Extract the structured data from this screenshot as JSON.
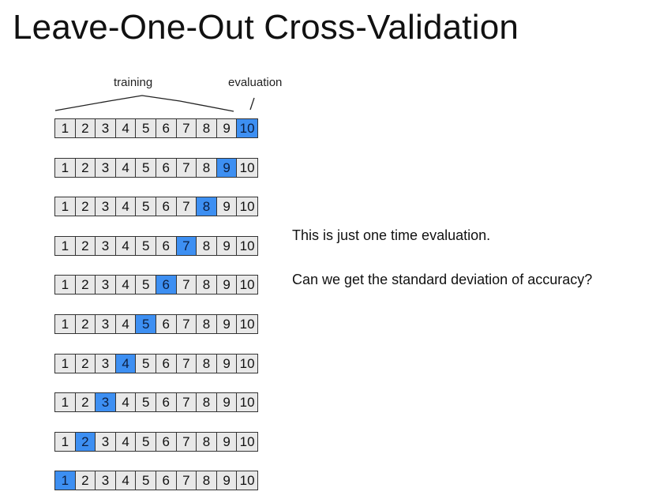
{
  "slide": {
    "title": "Leave-One-Out Cross-Validation"
  },
  "diagram": {
    "training_label": "training",
    "evaluation_label": "evaluation",
    "fold_labels": [
      "1",
      "2",
      "3",
      "4",
      "5",
      "6",
      "7",
      "8",
      "9",
      "10"
    ],
    "evaluation_fold_per_row": [
      10,
      9,
      8,
      7,
      6,
      5,
      4,
      3,
      2,
      1
    ],
    "colors": {
      "training_cell": "#e8e8e8",
      "evaluation_cell": "#3d8ff2",
      "border": "#333333"
    }
  },
  "notes": {
    "line1": "This is just one time evaluation.",
    "line2": "Can we get the standard deviation of accuracy?"
  }
}
